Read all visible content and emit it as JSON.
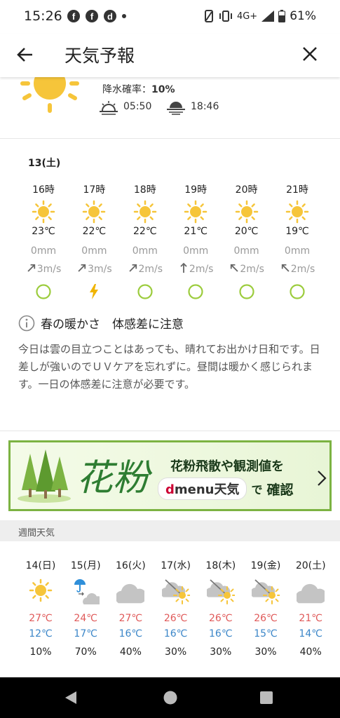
{
  "status_bar": {
    "time": "15:26",
    "network": "4G+",
    "battery": "61%"
  },
  "app_bar": {
    "title": "天気予報"
  },
  "today": {
    "precip_label": "降水確率：",
    "precip_value": "10%",
    "sunrise": "05:50",
    "sunset": "18:46"
  },
  "hourly": {
    "date_label": "13(土)",
    "items": [
      {
        "time": "16時",
        "icon": "sun-icon",
        "temp": "23℃",
        "precip": "0mm",
        "wind": "3m/s",
        "wind_dir": "northeast",
        "index": "circle"
      },
      {
        "time": "17時",
        "icon": "sun-icon",
        "temp": "22℃",
        "precip": "0mm",
        "wind": "3m/s",
        "wind_dir": "northeast",
        "index": "lightning"
      },
      {
        "time": "18時",
        "icon": "sun-icon",
        "temp": "22℃",
        "precip": "0mm",
        "wind": "2m/s",
        "wind_dir": "northeast",
        "index": "circle"
      },
      {
        "time": "19時",
        "icon": "sun-icon",
        "temp": "21℃",
        "precip": "0mm",
        "wind": "2m/s",
        "wind_dir": "north",
        "index": "circle"
      },
      {
        "time": "20時",
        "icon": "sun-icon",
        "temp": "20℃",
        "precip": "0mm",
        "wind": "2m/s",
        "wind_dir": "northwest",
        "index": "circle"
      },
      {
        "time": "21時",
        "icon": "sun-icon",
        "temp": "19℃",
        "precip": "0mm",
        "wind": "2m/s",
        "wind_dir": "northwest",
        "index": "circle"
      }
    ]
  },
  "advice": {
    "title": "春の暖かさ　体感差に注意",
    "body": "今日は雲の目立つことはあっても、晴れてお出かけ日和です。日差しが強いのでＵＶケアを忘れずに。昼間は暖かく感じられます。一日の体感差に注意が必要です。"
  },
  "banner": {
    "big_text": "花粉",
    "line1": "花粉飛散や観測値を",
    "brand_d": "d",
    "brand_menu": "menu",
    "brand_tenki": "天気",
    "de": "で",
    "kakunin": "確認",
    "colors": {
      "border": "#7cb342",
      "green_text": "#2e7d32",
      "brand_red": "#cc0033",
      "bg": "#eaf6d6"
    }
  },
  "weekly": {
    "section_label": "週間天気",
    "days": [
      {
        "day": "14(日)",
        "icon": "sun-icon",
        "high": "27℃",
        "low": "12℃",
        "precip": "10%"
      },
      {
        "day": "15(月)",
        "icon": "umbrella-then-cloud-icon",
        "high": "24℃",
        "low": "17℃",
        "precip": "70%"
      },
      {
        "day": "16(火)",
        "icon": "cloud-icon",
        "high": "27℃",
        "low": "16℃",
        "precip": "40%"
      },
      {
        "day": "17(水)",
        "icon": "cloud-sun-icon",
        "high": "26℃",
        "low": "16℃",
        "precip": "30%"
      },
      {
        "day": "18(木)",
        "icon": "cloud-sun-icon",
        "high": "26℃",
        "low": "16℃",
        "precip": "30%"
      },
      {
        "day": "19(金)",
        "icon": "cloud-sun-icon",
        "high": "26℃",
        "low": "15℃",
        "precip": "30%"
      },
      {
        "day": "20(土)",
        "icon": "cloud-icon",
        "high": "21℃",
        "low": "14℃",
        "precip": "40%"
      }
    ]
  }
}
